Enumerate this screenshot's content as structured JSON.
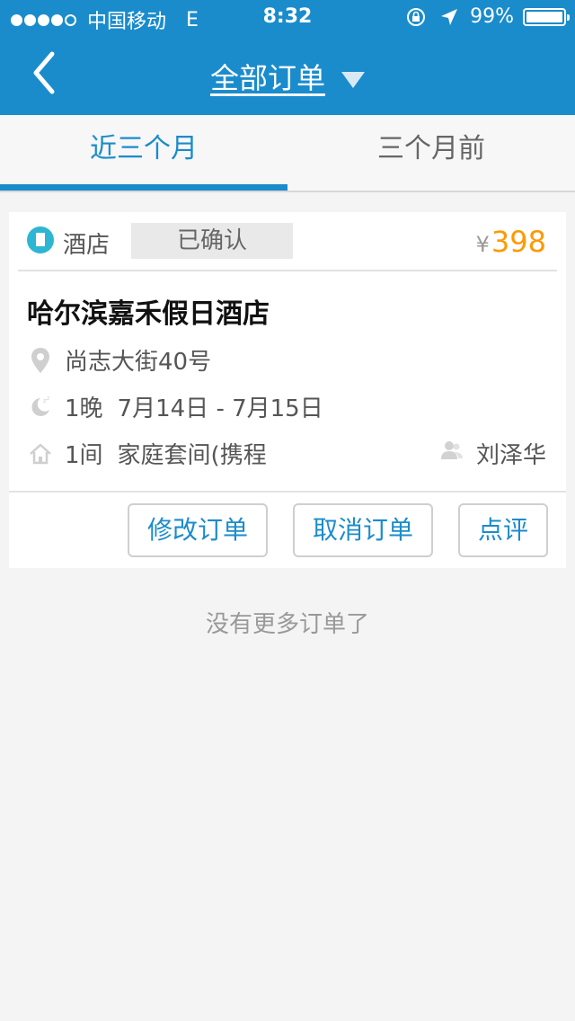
{
  "status_bar": {
    "carrier": "中国移动",
    "network": "E",
    "time": "8:32",
    "battery": "99%",
    "signal_bars_filled": 4,
    "signal_bars_total": 5,
    "battery_level": 0.99
  },
  "nav": {
    "back_icon": "chevron-left-icon",
    "title": "全部订单",
    "dropdown_icon": "caret-down-icon"
  },
  "tabs": [
    {
      "label": "近三个月",
      "active": true
    },
    {
      "label": "三个月前",
      "active": false
    }
  ],
  "colors": {
    "brand": "#1a8ccc",
    "price": "#ff9900",
    "hotel_icon": "#2db6d3"
  },
  "order": {
    "type_icon": "hotel-icon",
    "type": "酒店",
    "status": "已确认",
    "currency": "¥",
    "price": "398",
    "hotel_name": "哈尔滨嘉禾假日酒店",
    "address_icon": "location-pin-icon",
    "address": "尚志大街40号",
    "nights_icon": "moon-icon",
    "nights": "1晚",
    "dates": "7月14日 - 7月15日",
    "room_icon": "home-icon",
    "room_count": "1间",
    "room_type": "家庭套间(携程",
    "guest_icon": "person-icon",
    "guest": "刘泽华",
    "actions": {
      "modify": "修改订单",
      "cancel": "取消订单",
      "review": "点评"
    }
  },
  "footer_text": "没有更多订单了"
}
